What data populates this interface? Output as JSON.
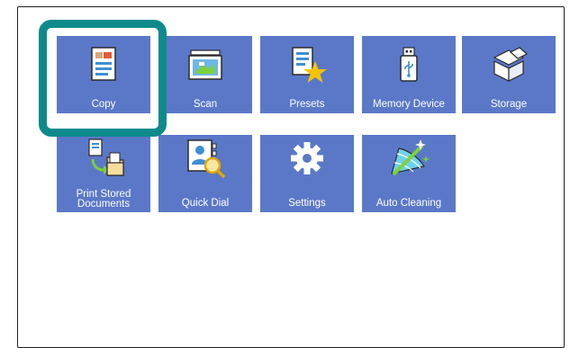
{
  "menu": {
    "tiles": [
      {
        "label": "Copy",
        "icon": "copy-icon"
      },
      {
        "label": "Scan",
        "icon": "scan-icon"
      },
      {
        "label": "Presets",
        "icon": "presets-icon"
      },
      {
        "label": "Memory Device",
        "icon": "usb-memory-icon"
      },
      {
        "label": "Storage",
        "icon": "storage-box-icon"
      },
      {
        "label": "Print Stored Documents",
        "icon": "print-stored-documents-icon"
      },
      {
        "label": "Quick Dial",
        "icon": "quick-dial-icon"
      },
      {
        "label": "Settings",
        "icon": "gear-icon"
      },
      {
        "label": "Auto Cleaning",
        "icon": "auto-cleaning-icon"
      }
    ],
    "selected": "Copy"
  },
  "colors": {
    "tile": "#5b78c8",
    "highlight": "#0f8a8c",
    "accent_yellow": "#f5c400",
    "accent_green": "#7dd13a"
  }
}
